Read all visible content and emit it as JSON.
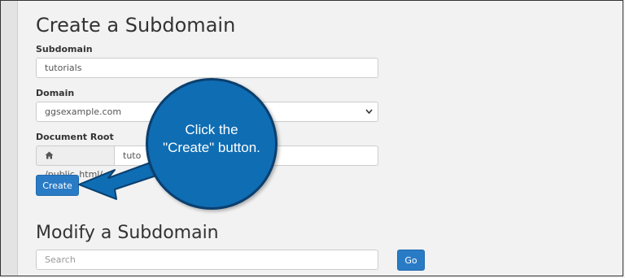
{
  "create": {
    "heading": "Create a Subdomain",
    "subdomain_label": "Subdomain",
    "subdomain_value": "tutorials",
    "domain_label": "Domain",
    "domain_value": "ggsexample.com",
    "docroot_label": "Document Root",
    "docroot_prefix": "/public_html/",
    "docroot_value": "tuto",
    "create_button": "Create"
  },
  "modify": {
    "heading": "Modify a Subdomain",
    "search_placeholder": "Search",
    "go_button": "Go"
  },
  "callout": {
    "line1": "Click the",
    "line2": "\"Create\" button."
  },
  "colors": {
    "primary_button": "#2a7bc6",
    "callout_fill": "#0f6db3",
    "callout_border": "#0b3f6e"
  },
  "icons": {
    "home": "home-icon",
    "chevron": "chevron-down-icon"
  }
}
